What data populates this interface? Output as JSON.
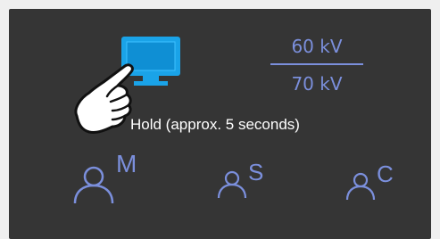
{
  "kv": {
    "upper": "60 kV",
    "lower": "70 kV"
  },
  "hint": "Hold (approx. 5 seconds)",
  "users": {
    "m": {
      "letter": "M"
    },
    "s": {
      "letter": "S"
    },
    "c": {
      "letter": "C"
    }
  },
  "colors": {
    "accent": "#7b8fdc",
    "monitor": "#1aa3e8",
    "panel": "#353535"
  }
}
